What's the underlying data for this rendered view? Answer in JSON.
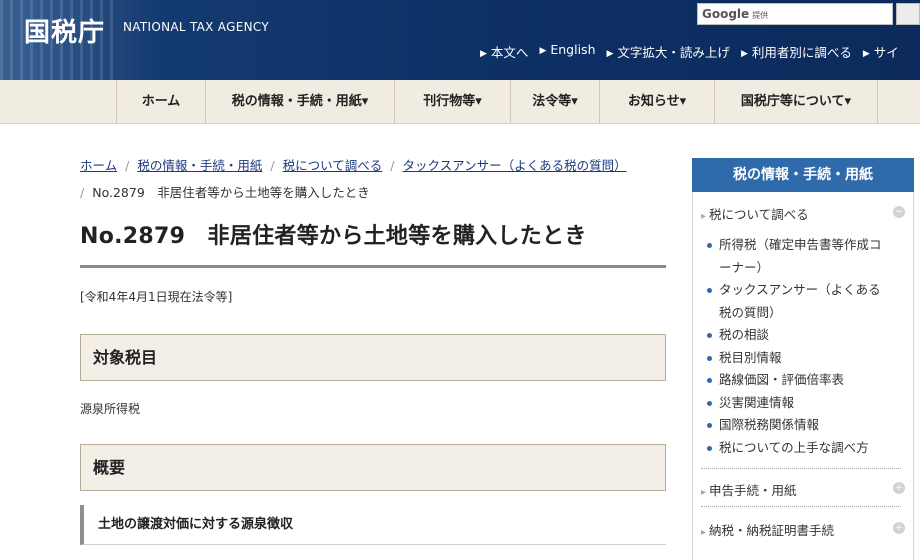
{
  "header": {
    "logo": "国税庁",
    "logo_en": "NATIONAL TAX AGENCY",
    "search_brand": "Google",
    "search_brand_sub": "提供",
    "search_placeholder": "",
    "utility_links": [
      "本文へ",
      "English",
      "文字拡大・読み上げ",
      "利用者別に調べる",
      "サイ"
    ]
  },
  "nav": [
    "ホーム",
    "税の情報・手続・用紙▾",
    "刊行物等▾",
    "法令等▾",
    "お知らせ▾",
    "国税庁等について▾"
  ],
  "breadcrumb": {
    "links": [
      "ホーム",
      "税の情報・手続・用紙",
      "税について調べる",
      "タックスアンサー（よくある税の質問）"
    ],
    "current": "No.2879　非居住者等から土地等を購入したとき"
  },
  "page_title": "No.2879　非居住者等から土地等を購入したとき",
  "as_of": "[令和4年4月1日現在法令等]",
  "sections": {
    "target_tax_heading": "対象税目",
    "target_tax_body": "源泉所得税",
    "overview_heading": "概要",
    "sub_heading": "土地の譲渡対価に対する源泉徴収"
  },
  "sidebar": {
    "heading": "税の情報・手続・用紙",
    "group1": "税について調べる",
    "items": [
      "所得税（確定申告書等作成コーナー）",
      "タックスアンサー（よくある税の質問）",
      "税の相談",
      "税目別情報",
      "路線価図・評価倍率表",
      "災害関連情報",
      "国際税務関係情報",
      "税についての上手な調べ方"
    ],
    "group2": "申告手続・用紙",
    "group3": "納税・納税証明書手続"
  },
  "colors": {
    "header_bg": "#0d2f63",
    "nav_bg": "#f1ece2",
    "sidebar_head": "#2f6aab",
    "link": "#1a3a7c"
  }
}
